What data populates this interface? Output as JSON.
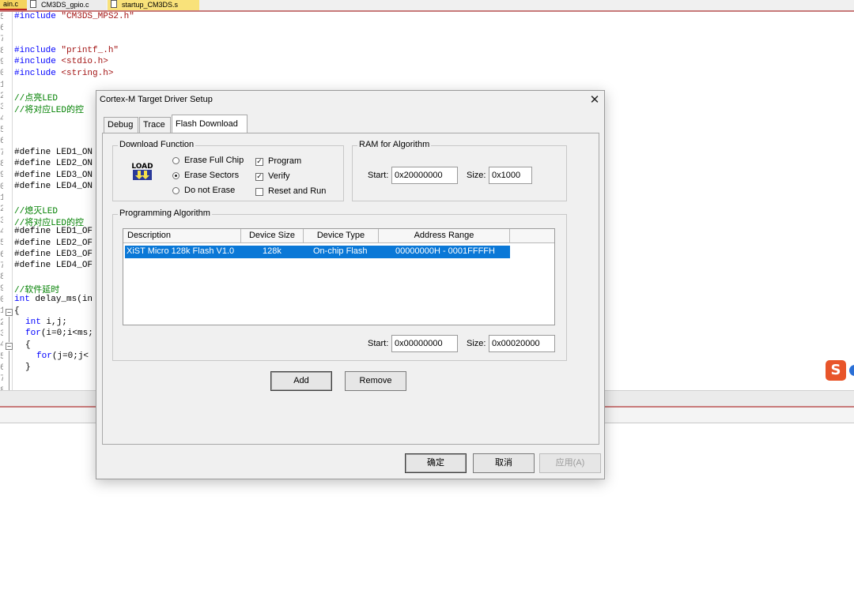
{
  "editor": {
    "tabs": [
      {
        "label": "ain.c"
      },
      {
        "label": "CM3DS_gpio.c"
      },
      {
        "label": "startup_CM3DS.s"
      }
    ],
    "line_numbers": [
      "5",
      "6",
      "7",
      "8",
      "9",
      "0",
      "1",
      "2",
      "3",
      "4",
      "5",
      "6",
      "7",
      "8",
      "9",
      "0",
      "1",
      "2",
      "3",
      "4",
      "5",
      "6",
      "7",
      "8",
      "9",
      "0",
      "1",
      "2",
      "3",
      "4",
      "5",
      "6",
      "7",
      "8"
    ],
    "code_lines": {
      "l1_kw": "#include",
      "l1_str": "\"CM3DS_MPS2.h\"",
      "l4_kw": "#include",
      "l4_str": "\"printf_.h\"",
      "l5_kw": "#include",
      "l5_str": "<stdio.h>",
      "l6_kw": "#include",
      "l6_str": "<string.h>",
      "l8": "//点亮LED",
      "l9": "//将对应LED的控",
      "l13": "#define LED1_ON",
      "l14": "#define LED2_ON",
      "l15": "#define LED3_ON",
      "l16": "#define LED4_ON",
      "l18": "//熄灭LED",
      "l19": "//将对应LED的控",
      "l20": "#define LED1_OF",
      "l21": "#define LED2_OF",
      "l22": "#define LED3_OF",
      "l23": "#define LED4_OF",
      "l25": "//软件延时",
      "l26_kw": "int",
      "l26": " delay_ms(in",
      "l27": "{",
      "l28_kw": "int",
      "l28": " i,j;",
      "l29_kw": "for",
      "l29": "(i=0;i<ms;",
      "l30": "{",
      "l31_kw": "for",
      "l31": "(j=0;j<",
      "l32": "}"
    }
  },
  "dialog": {
    "title": "Cortex-M Target Driver Setup",
    "close_glyph": "✕",
    "tabs": [
      {
        "label": "Debug"
      },
      {
        "label": "Trace"
      },
      {
        "label": "Flash Download"
      }
    ],
    "download_function": {
      "label": "Download Function",
      "radios": [
        {
          "label": "Erase Full Chip",
          "checked": false
        },
        {
          "label": "Erase Sectors",
          "checked": true
        },
        {
          "label": "Do not Erase",
          "checked": false
        }
      ],
      "checks": [
        {
          "label": "Program",
          "checked": true
        },
        {
          "label": "Verify",
          "checked": true
        },
        {
          "label": "Reset and Run",
          "checked": false
        }
      ],
      "icon": "load-icon",
      "icon_text": "LOAD"
    },
    "ram": {
      "label": "RAM for Algorithm",
      "start_label": "Start:",
      "start_value": "0x20000000",
      "size_label": "Size:",
      "size_value": "0x1000"
    },
    "prog_algo": {
      "label": "Programming Algorithm",
      "columns": [
        "Description",
        "Device Size",
        "Device Type",
        "Address Range"
      ],
      "rows": [
        {
          "description": "XiST Micro 128k Flash V1.0",
          "device_size": "128k",
          "device_type": "On-chip Flash",
          "address_range": "00000000H - 0001FFFFH"
        }
      ],
      "start_label": "Start:",
      "start_value": "0x00000000",
      "size_label": "Size:",
      "size_value": "0x00020000"
    },
    "buttons": {
      "add": "Add",
      "remove": "Remove",
      "ok": "确定",
      "cancel": "取消",
      "apply": "应用(A)"
    }
  },
  "colors": {
    "selection": "#0a78d7",
    "keyword": "#0000ff",
    "string": "#a31515",
    "comment": "#008000"
  }
}
